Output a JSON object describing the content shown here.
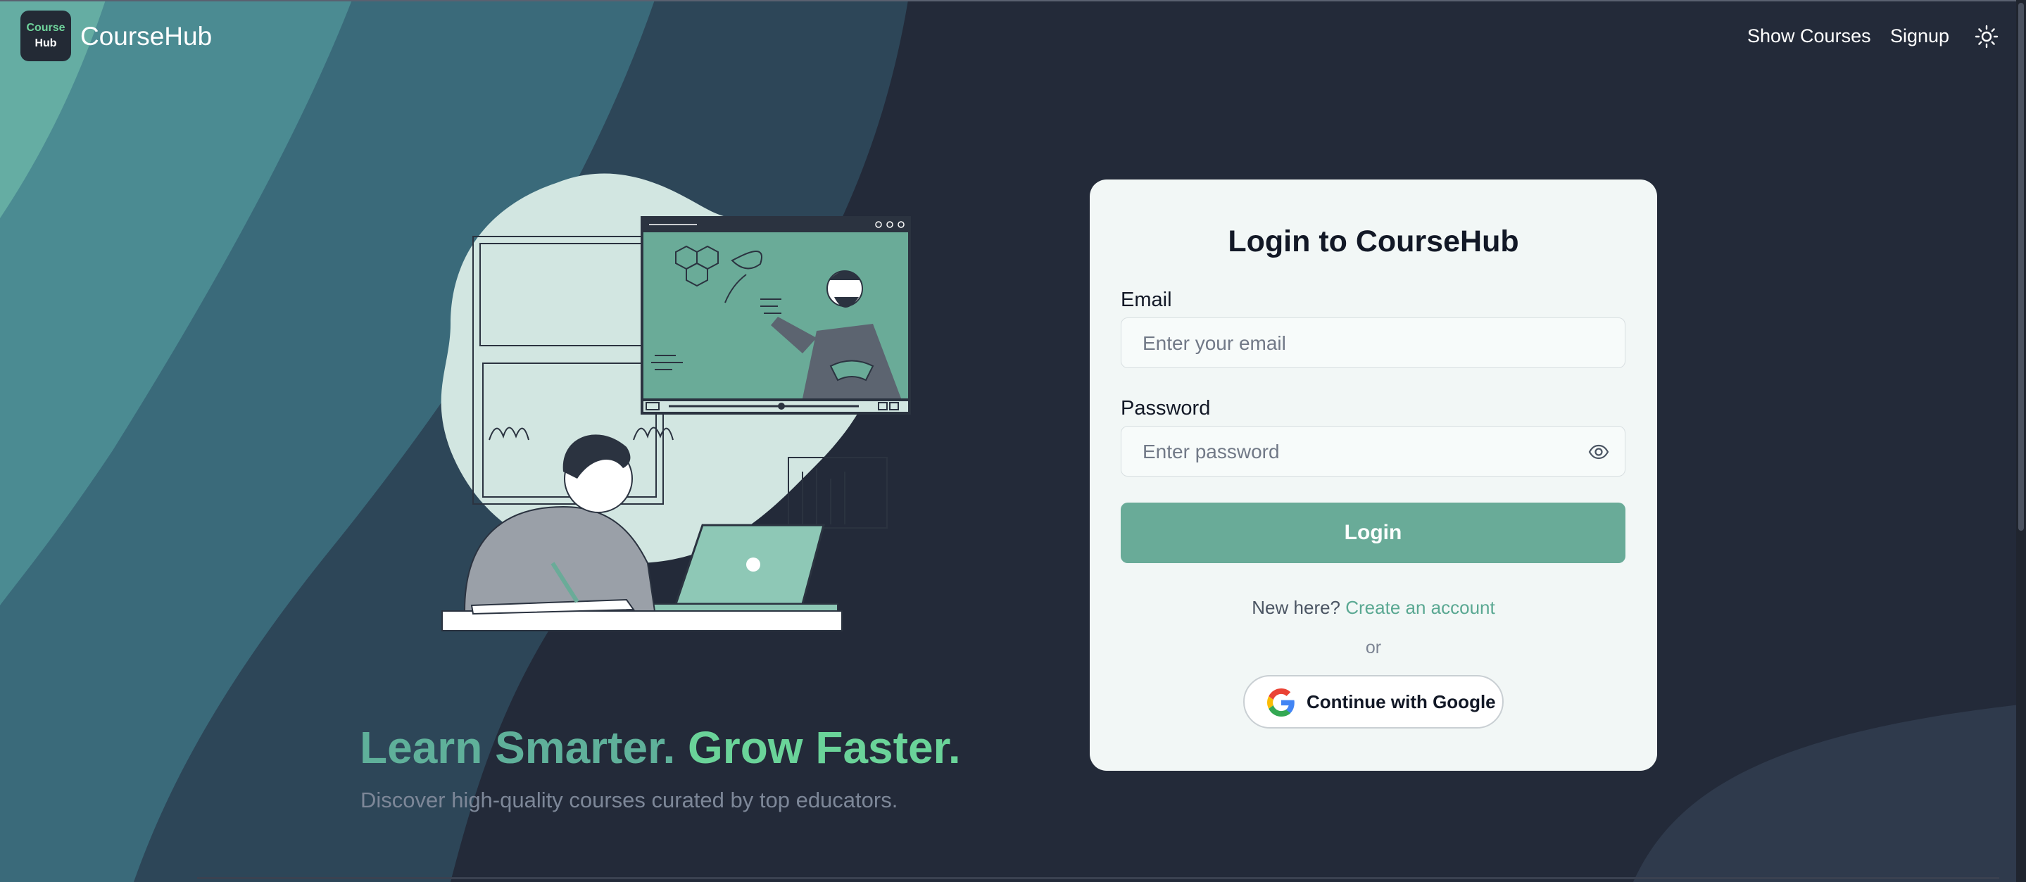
{
  "app": {
    "logo_line1": "Course",
    "logo_line2": "Hub",
    "name": "CourseHub"
  },
  "nav": {
    "show_courses": "Show Courses",
    "signup": "Signup",
    "theme_toggle_icon": "sun-icon"
  },
  "hero": {
    "title_part1": "Learn Smarter.",
    "title_part2": "Grow Faster.",
    "subtitle": "Discover high-quality courses curated by top educators.",
    "illustration_icon": "online-learning-illustration"
  },
  "login": {
    "title": "Login to CourseHub",
    "email_label": "Email",
    "email_placeholder": "Enter your email",
    "email_value": "",
    "password_label": "Password",
    "password_placeholder": "Enter password",
    "password_value": "",
    "show_password_icon": "eye-icon",
    "login_button": "Login",
    "new_here": "New here?",
    "create_account": "Create an account",
    "or": "or",
    "google_button": "Continue with Google",
    "google_icon": "google-icon"
  },
  "colors": {
    "page_bg": "#232a39",
    "accent": "#69ab98",
    "hero_green": "#6ad399",
    "card_bg": "#f2f7f6"
  }
}
